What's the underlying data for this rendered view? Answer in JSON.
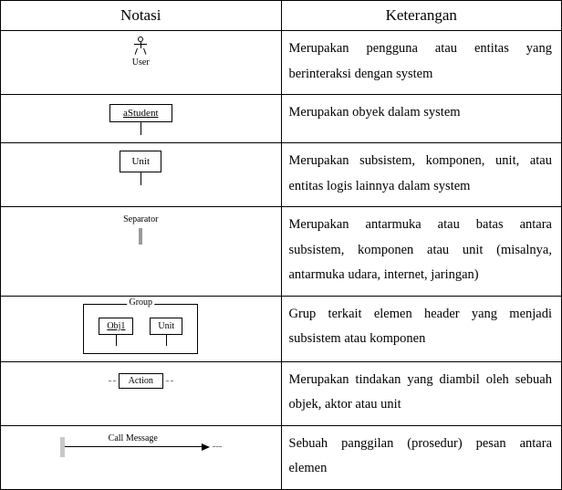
{
  "headers": {
    "notasi": "Notasi",
    "keterangan": "Keterangan"
  },
  "rows": [
    {
      "label": "User",
      "desc": "Merupakan pengguna atau entitas yang berinteraksi dengan system"
    },
    {
      "label": "aStudent",
      "desc": "Merupakan obyek dalam system"
    },
    {
      "label": "Unit",
      "desc": "Merupakan subsistem, komponen, unit, atau entitas logis lainnya dalam system"
    },
    {
      "label": "Separator",
      "desc": "Merupakan antarmuka atau batas antara subsistem, komponen atau unit (misalnya, antarmuka udara, internet, jaringan)"
    },
    {
      "group_label": "Group",
      "obj1": "Obj1",
      "unit": "Unit",
      "desc": "Grup terkait elemen header yang menjadi subsistem atau komponen"
    },
    {
      "label": "Action",
      "desc": "Merupakan tindakan yang diambil oleh sebuah objek, aktor atau unit"
    },
    {
      "label": "Call Message",
      "desc": "Sebuah panggilan (prosedur) pesan antara elemen"
    }
  ]
}
